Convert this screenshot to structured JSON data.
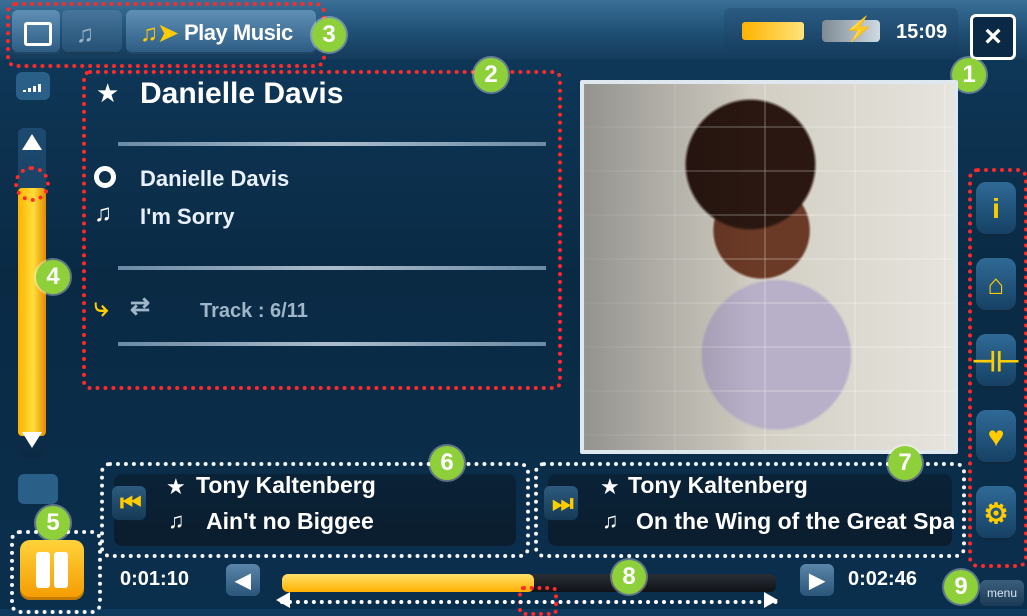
{
  "top_bar": {
    "active_tab_label": "Play Music",
    "time": "15:09",
    "icons": [
      "window-switch-icon",
      "music-notes-icon",
      "play-music-icon",
      "battery-icon",
      "power-icon",
      "close-icon"
    ]
  },
  "now_playing": {
    "artist_title": "Danielle Davis",
    "album": "Danielle Davis",
    "song": "I'm Sorry",
    "track_text": "Track : 6/11"
  },
  "prev_track": {
    "artist": "Tony Kaltenberg",
    "song": "Ain't no Biggee"
  },
  "next_track": {
    "artist": "Tony Kaltenberg",
    "song": "On the Wing of the Great Spa"
  },
  "playback": {
    "time_elapsed": "0:01:10",
    "time_total": "0:02:46",
    "progress_fraction": 0.51
  },
  "buttons": {
    "menu_label": "menu"
  },
  "callouts": {
    "badges": [
      "1",
      "2",
      "3",
      "4",
      "5",
      "6",
      "7",
      "8",
      "9"
    ]
  },
  "colors": {
    "accent_yellow": "#ffcc00",
    "callout_red": "#ff2a2a",
    "callout_green": "#8ed03a",
    "bg_blue": "#0a2a44"
  }
}
